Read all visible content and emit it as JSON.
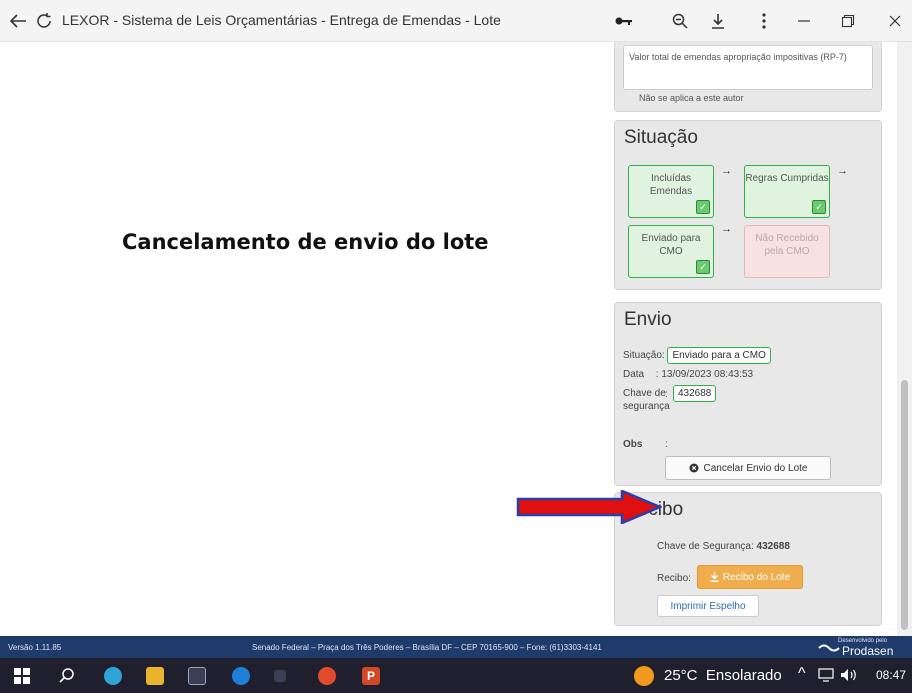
{
  "window": {
    "title": "LEXOR - Sistema de Leis Orçamentárias - Entrega de Emendas - Lote",
    "icons": [
      "back-arrow-icon",
      "refresh-icon",
      "key-icon",
      "zoom-icon",
      "download-icon",
      "more-icon",
      "minimize-icon",
      "restore-icon",
      "close-icon"
    ]
  },
  "annotation": "Cancelamento de envio do lote",
  "rp7": {
    "label": "Valor total de emendas apropriação impositivas (RP-7)",
    "note": "Não se aplica a este autor"
  },
  "situacao": {
    "title": "Situação",
    "steps": [
      {
        "label": "Incluídas Emendas",
        "done": true
      },
      {
        "label": "Regras Cumpridas",
        "done": true
      },
      {
        "label": "Enviado para CMO",
        "done": true
      },
      {
        "label": "Não Recebido pela CMO",
        "done": false
      }
    ]
  },
  "envio": {
    "title": "Envio",
    "situacao_label": "Situação:",
    "situacao_value": "Enviado para a CMO",
    "data_label": "Data",
    "data_value": ": 13/09/2023 08:43:53",
    "chave_label": "Chave de segurança",
    "chave_sep": ":",
    "chave_value": "432688",
    "obs_label": "Obs",
    "obs_sep": ":",
    "cancel_button": "Cancelar Envio do Lote"
  },
  "recibo": {
    "title": "Recibo",
    "chave_text": "Chave de Segurança:",
    "chave_value": "432688",
    "recibo_label": "Recibo:",
    "recibo_button": "Recibo do Lote",
    "imprimir_button": "Imprimir Espelho"
  },
  "footer": {
    "version": "Versão 1.11.85",
    "address": "Senado Federal – Praça dos Três Poderes – Brasília DF – CEP 70165-900 – Fone: (61)3303-4141",
    "dev_small": "Desenvolvido pelo",
    "dev_brand": "Prodasen"
  },
  "taskbar": {
    "weather": "25°C  Ensolarado",
    "time": "08:47"
  },
  "colors": {
    "green_border": "#2fb24a",
    "orange_button": "#f0ad4e",
    "footer_blue": "#1e3b6b",
    "arrow_red": "#e01010"
  }
}
